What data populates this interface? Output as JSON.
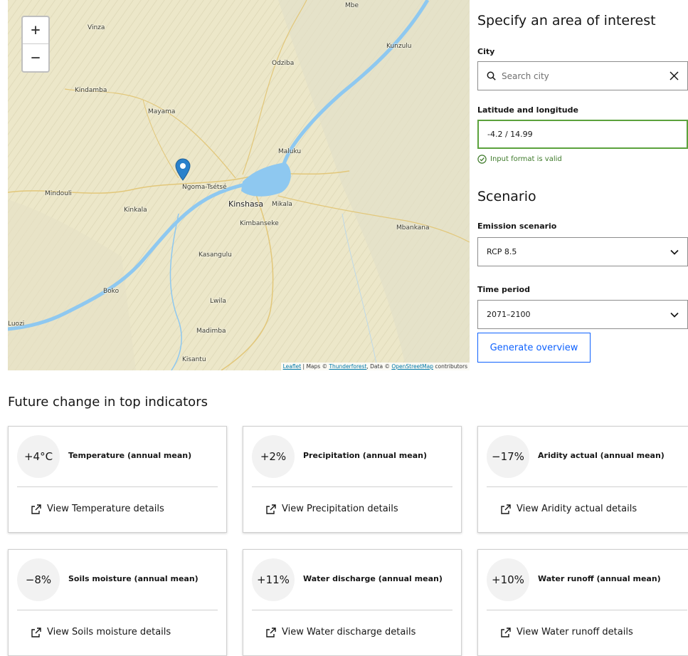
{
  "map": {
    "zoom_in": "+",
    "zoom_out": "−",
    "places": {
      "vinza": "Vinza",
      "mbe": "Mbe",
      "kunzulu": "Kunzulu",
      "odziba": "Odziba",
      "kindamba": "Kindamba",
      "mayama": "Mayama",
      "maluku": "Maluku",
      "ngoma": "Ngoma-Tsétsé",
      "mindouli": "Mindouli",
      "kinkala": "Kinkala",
      "kinshasa": "Kinshasa",
      "mikala": "Mikala",
      "kimbanseke": "Kimbanseke",
      "mbankana": "Mbankana",
      "kasangulu": "Kasangulu",
      "boko": "Boko",
      "lwila": "Lwila",
      "luozi": "Luozi",
      "madimba": "Madimba",
      "kisantu": "Kisantu"
    },
    "attribution": {
      "leaflet": "Leaflet",
      "sep1": " | Maps © ",
      "thunderforest": "Thunderforest",
      "sep2": ", Data © ",
      "osm": "OpenStreetMap",
      "tail": " contributors"
    }
  },
  "panel": {
    "area_title": "Specify an area of interest",
    "city_label": "City",
    "city_placeholder": "Search city",
    "latlon_label": "Latitude and longitude",
    "latlon_value": "-4.2 / 14.99",
    "valid_msg": "Input format is valid",
    "scenario_title": "Scenario",
    "emission_label": "Emission scenario",
    "emission_value": "RCP 8.5",
    "period_label": "Time period",
    "period_value": "2071–2100",
    "generate_button": "Generate overview"
  },
  "indicators": {
    "title": "Future change in top indicators",
    "cards": [
      {
        "value": "+4°C",
        "name": "Temperature (annual mean)",
        "link": "View Temperature details"
      },
      {
        "value": "+2%",
        "name": "Precipitation (annual mean)",
        "link": "View Precipitation details"
      },
      {
        "value": "−17%",
        "name": "Aridity actual (annual mean)",
        "link": "View Aridity actual details"
      },
      {
        "value": "−8%",
        "name": "Soils moisture (annual mean)",
        "link": "View Soils moisture details"
      },
      {
        "value": "+11%",
        "name": "Water discharge (annual mean)",
        "link": "View Water discharge details"
      },
      {
        "value": "+10%",
        "name": "Water runoff (annual mean)",
        "link": "View Water runoff details"
      }
    ]
  },
  "colors": {
    "accent": "#0f62fe",
    "valid": "#5ba23c",
    "river": "#8ec8f0",
    "marker": "#2a81cb"
  }
}
